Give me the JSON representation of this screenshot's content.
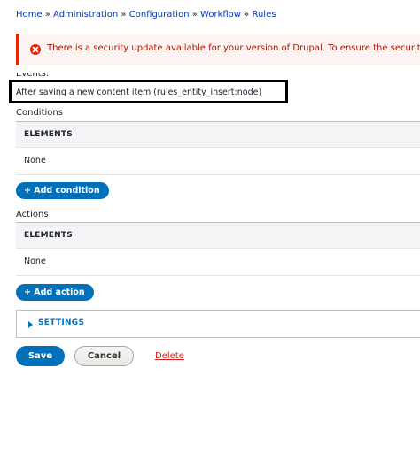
{
  "breadcrumb": {
    "items": [
      "Home",
      "Administration",
      "Configuration",
      "Workflow",
      "Rules"
    ],
    "separator": "»"
  },
  "alert": {
    "message": "There is a security update available for your version of Drupal. To ensure the security of your server, you should update immediately!",
    "icon": "error-icon",
    "color": "#e62600"
  },
  "events": {
    "label": "Events:",
    "item": "After saving a new content item (rules_entity_insert:node)"
  },
  "conditions": {
    "label": "Conditions",
    "header": "ELEMENTS",
    "empty": "None",
    "add_button": "+ Add condition"
  },
  "actions": {
    "label": "Actions",
    "header": "ELEMENTS",
    "empty": "None",
    "add_button": "+ Add action"
  },
  "settings": {
    "label": "SETTINGS",
    "expanded": false
  },
  "form": {
    "save": "Save",
    "cancel": "Cancel",
    "delete": "Delete"
  },
  "colors": {
    "primary": "#0071b8",
    "error": "#e62600",
    "link": "#0036b1",
    "danger_link": "#d72222"
  }
}
